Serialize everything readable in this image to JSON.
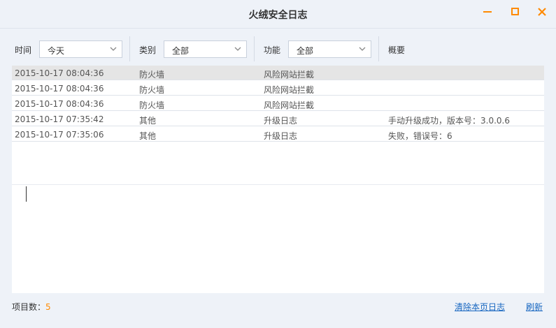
{
  "window": {
    "title": "火绒安全日志"
  },
  "filters": {
    "time": {
      "label": "时间",
      "value": "今天"
    },
    "category": {
      "label": "类别",
      "value": "全部"
    },
    "function": {
      "label": "功能",
      "value": "全部"
    },
    "summary_label": "概要"
  },
  "log": {
    "rows": [
      {
        "time": "2015-10-17 08:04:36",
        "category": "防火墙",
        "function": "风险网站拦截",
        "summary": ""
      },
      {
        "time": "2015-10-17 08:04:36",
        "category": "防火墙",
        "function": "风险网站拦截",
        "summary": ""
      },
      {
        "time": "2015-10-17 08:04:36",
        "category": "防火墙",
        "function": "风险网站拦截",
        "summary": ""
      },
      {
        "time": "2015-10-17 07:35:42",
        "category": "其他",
        "function": "升级日志",
        "summary": "手动升级成功，版本号：3.0.0.6"
      },
      {
        "time": "2015-10-17 07:35:06",
        "category": "其他",
        "function": "升级日志",
        "summary": "失败，错误号：6"
      }
    ]
  },
  "footer": {
    "count_label": "项目数：",
    "count": "5",
    "clear_label": "清除本页日志",
    "refresh_label": "刷新"
  },
  "colors": {
    "accent": "#ff8a00",
    "link": "#1565c0",
    "background": "#eef2f8"
  }
}
